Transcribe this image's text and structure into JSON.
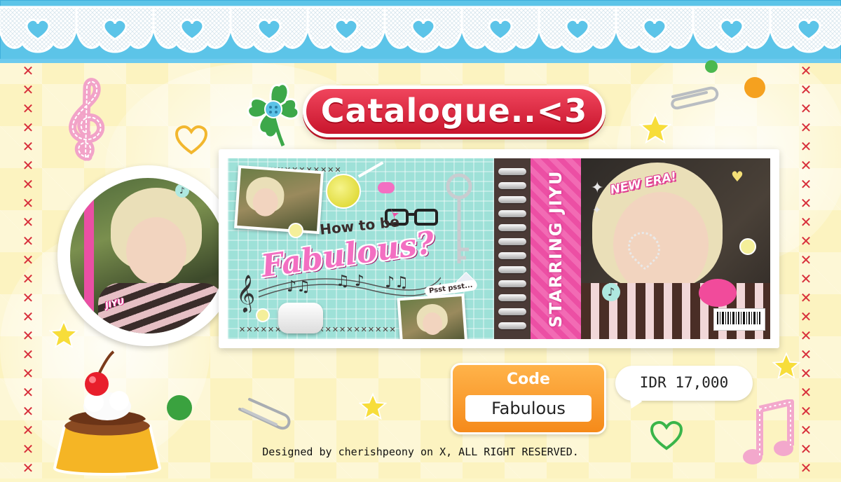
{
  "title": "Catalogue..<3",
  "banner": {
    "how_to_be": "How to be",
    "fabulous_script": "Fabulous?",
    "pssst": "Psst psst...",
    "starring": "STARRING JIYU",
    "new_era": "NEW ERA!"
  },
  "portrait": {
    "tag": "JIYU"
  },
  "code": {
    "label": "Code",
    "value": "Fabulous"
  },
  "price": "IDR 17,000",
  "footer": "Designed by cherishpeony on X, ALL RIGHT RESERVED.",
  "colors": {
    "title_red": "#d9213a",
    "lace_blue": "#5cc4e8",
    "code_orange": "#f58a1a",
    "border_x_red": "#d72e3a",
    "background_yellow": "#fcf3c0",
    "accent_pink": "#ec4fa4"
  },
  "icons": [
    "clover-icon",
    "treble-clef-icon",
    "music-note-icon",
    "heart-icon",
    "star-icon",
    "paperclip-icon",
    "pudding-icon",
    "key-icon",
    "glasses-icon",
    "barcode-icon"
  ]
}
